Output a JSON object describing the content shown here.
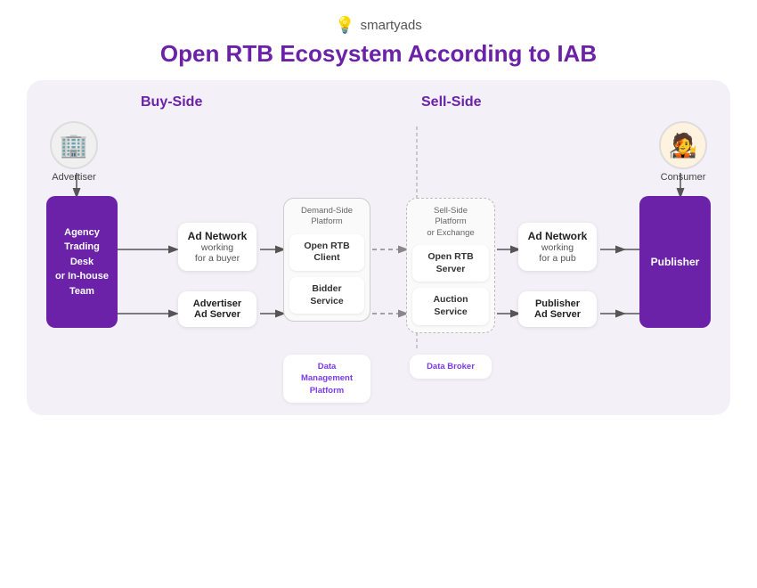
{
  "logo": {
    "text": "smartyads",
    "icon": "💡"
  },
  "title": "Open RTB Ecosystem According to IAB",
  "labels": {
    "buy_side": "Buy-Side",
    "sell_side": "Sell-Side"
  },
  "advertiser": {
    "icon": "🏢",
    "label": "Advertiser"
  },
  "consumer": {
    "icon": "👤",
    "label": "Consumer"
  },
  "agency": {
    "line1": "Agency",
    "line2": "Trading Desk",
    "line3": "or In-house",
    "line4": "Team"
  },
  "publisher": {
    "label": "Publisher"
  },
  "buy_network": {
    "title": "Ad Network",
    "sub": "working\nfor a buyer"
  },
  "advertiser_ad_server": {
    "title": "Advertiser",
    "sub": "Ad Server"
  },
  "dsp": {
    "container_label": "Demand-Side\nPlatform",
    "open_rtb_client": "Open RTB\nClient",
    "bidder_service": "Bidder\nService",
    "data_mgmt": "Data\nManagement\nPlatform"
  },
  "ssp": {
    "container_label": "Sell-Side\nPlatform\nor Exchange",
    "open_rtb_server": "Open RTB\nServer",
    "auction_service": "Auction\nService",
    "data_broker": "Data Broker"
  },
  "sell_network": {
    "title": "Ad Network",
    "sub": "working\nfor a pub"
  },
  "publisher_ad_server": {
    "title": "Publisher",
    "sub": "Ad Server"
  }
}
